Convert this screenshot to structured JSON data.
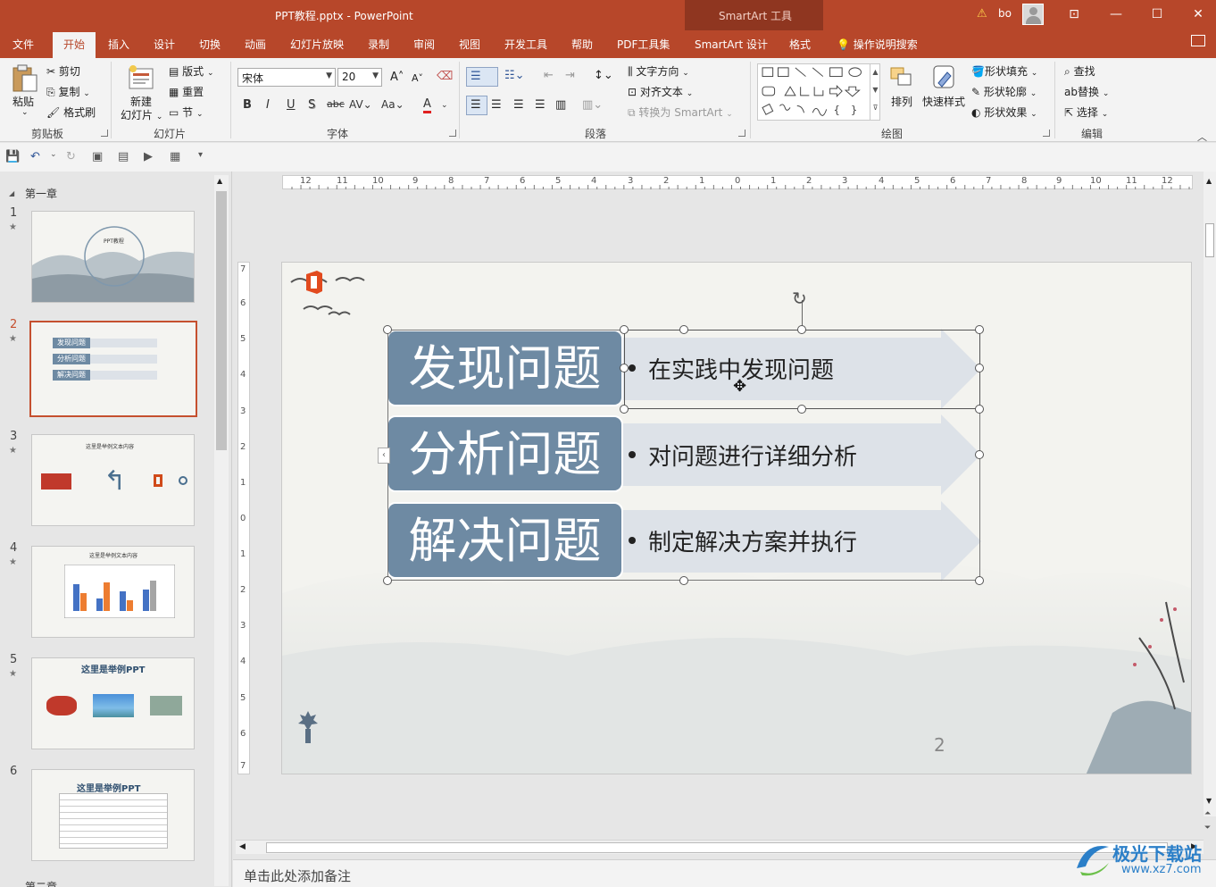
{
  "window": {
    "title": "PPT教程.pptx  -  PowerPoint",
    "context_tab_group": "SmartArt 工具",
    "user": "bo"
  },
  "ribbon_tabs": [
    "文件",
    "开始",
    "插入",
    "设计",
    "切换",
    "动画",
    "幻灯片放映",
    "录制",
    "审阅",
    "视图",
    "开发工具",
    "帮助",
    "PDF工具集",
    "SmartArt 设计",
    "格式"
  ],
  "active_tab": "开始",
  "tell_me": "操作说明搜索",
  "clipboard": {
    "paste": "粘贴",
    "cut": "剪切",
    "copy": "复制",
    "format_painter": "格式刷",
    "group": "剪贴板"
  },
  "slides_group": {
    "new_slide_1": "新建",
    "new_slide_2": "幻灯片",
    "layout": "版式",
    "reset": "重置",
    "section": "节",
    "group": "幻灯片"
  },
  "font_group": {
    "font_name": "宋体",
    "font_size": "20",
    "group": "字体"
  },
  "paragraph_group": {
    "text_direction": "文字方向",
    "align_text": "对齐文本",
    "convert_smartart": "转换为 SmartArt",
    "group": "段落"
  },
  "drawing_group": {
    "arrange": "排列",
    "quick_styles": "快速样式",
    "shape_fill": "形状填充",
    "shape_outline": "形状轮廓",
    "shape_effects": "形状效果",
    "group": "绘图"
  },
  "editing_group": {
    "find": "查找",
    "replace": "替换",
    "select": "选择",
    "group": "编辑"
  },
  "thumbnails": {
    "section1": "第一章",
    "section2": "第二章",
    "slides": [
      {
        "num": "1",
        "caption": "PPT教程"
      },
      {
        "num": "2",
        "items": [
          "发现问题",
          "分析问题",
          "解决问题"
        ]
      },
      {
        "num": "3",
        "caption": "这里是举例文本内容"
      },
      {
        "num": "4",
        "caption": "这里是举例文本内容"
      },
      {
        "num": "5",
        "caption": "这里是举例PPT"
      },
      {
        "num": "6",
        "caption": "这里是举例PPT"
      }
    ]
  },
  "rulers": {
    "horizontal": [
      "12",
      "11",
      "10",
      "9",
      "8",
      "7",
      "6",
      "5",
      "4",
      "3",
      "2",
      "1",
      "0",
      "1",
      "2",
      "3",
      "4",
      "5",
      "6",
      "7",
      "8",
      "9",
      "10",
      "11",
      "12"
    ],
    "vertical": [
      "7",
      "6",
      "5",
      "4",
      "3",
      "2",
      "1",
      "0",
      "1",
      "2",
      "3",
      "4",
      "5",
      "6",
      "7"
    ]
  },
  "slide": {
    "rows": [
      {
        "label": "发现问题",
        "text": "在实践中发现问题"
      },
      {
        "label": "分析问题",
        "text": "对问题进行详细分析"
      },
      {
        "label": "解决问题",
        "text": "制定解决方案并执行"
      }
    ],
    "page_number": "2"
  },
  "notes_placeholder": "单击此处添加备注",
  "watermark": {
    "line1": "极光下载站",
    "line2": "www.xz7.com"
  },
  "colors": {
    "accent": "#b7472a",
    "row_fill": "#6e8aa3",
    "arrow_fill": "#dde2e8"
  }
}
